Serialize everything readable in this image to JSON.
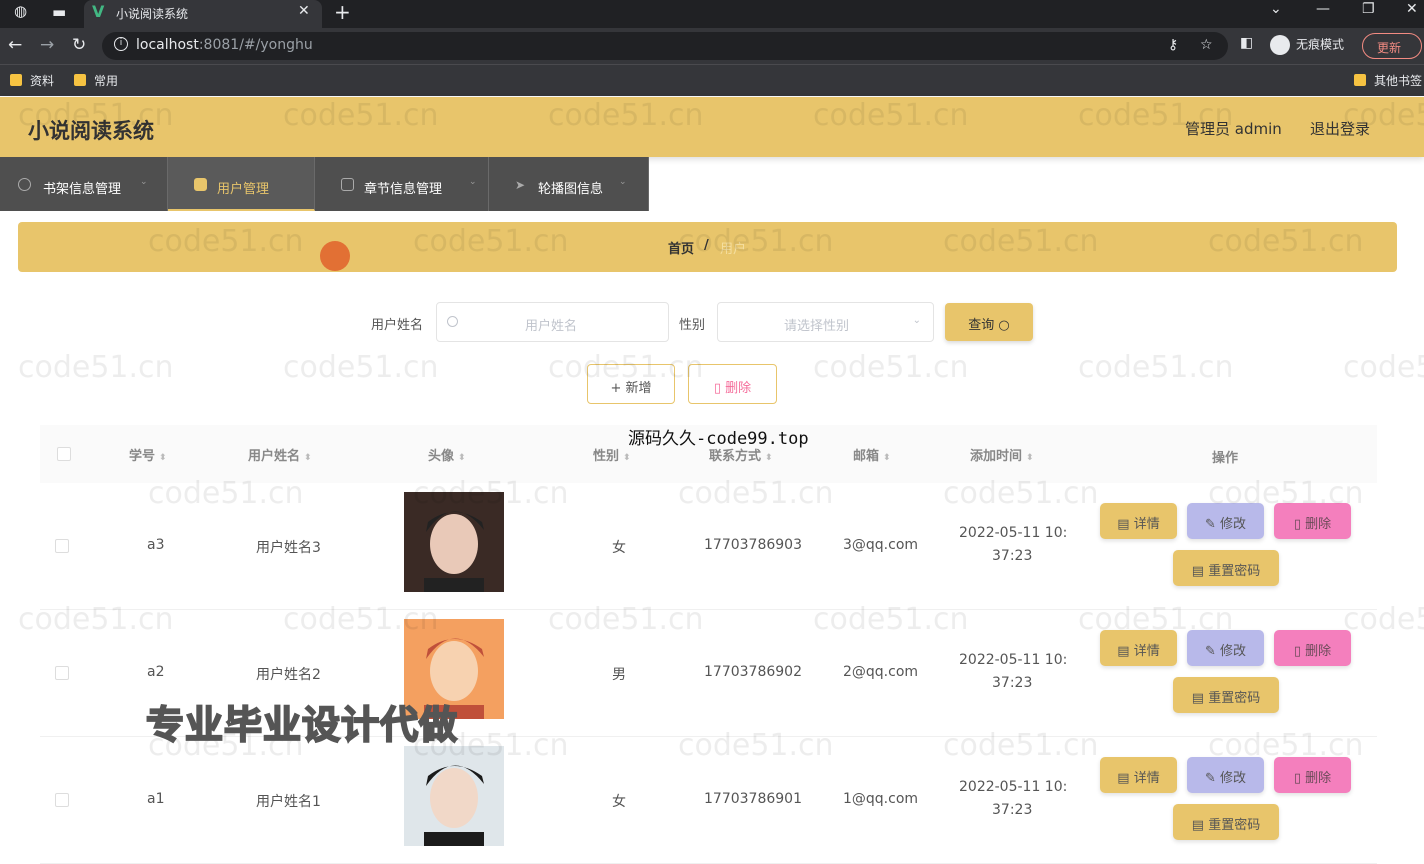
{
  "browser": {
    "tab_title": "小说阅读系统",
    "url_host": "localhost",
    "url_rest": ":8081/#/yonghu",
    "incognito_label": "无痕模式",
    "update_label": "更新",
    "bookmarks": [
      "资料",
      "常用"
    ],
    "other_bookmarks": "其他书签"
  },
  "app": {
    "title": "小说阅读系统",
    "user_label": "管理员 admin",
    "logout_label": "退出登录"
  },
  "menu": [
    {
      "label": "书架信息管理",
      "icon": "compass-icon"
    },
    {
      "label": "用户管理",
      "icon": "user-card-icon"
    },
    {
      "label": "章节信息管理",
      "icon": "document-icon"
    },
    {
      "label": "轮播图信息",
      "icon": "send-icon"
    }
  ],
  "breadcrumb": {
    "home": "首页",
    "sep": "/",
    "current": "用户"
  },
  "search": {
    "name_label": "用户姓名",
    "name_placeholder": "用户姓名",
    "gender_label": "性别",
    "gender_placeholder": "请选择性别",
    "query_label": "查询"
  },
  "toolbar": {
    "add_label": "+ 新增",
    "delete_label": "删除"
  },
  "table": {
    "columns": [
      "学号",
      "用户姓名",
      "头像",
      "性别",
      "联系方式",
      "邮箱",
      "添加时间",
      "操作"
    ],
    "rows": [
      {
        "id": "a3",
        "name": "用户姓名3",
        "gender": "女",
        "phone": "17703786903",
        "email": "3@qq.com",
        "time1": "2022-05-11 10:",
        "time2": "37:23"
      },
      {
        "id": "a2",
        "name": "用户姓名2",
        "gender": "男",
        "phone": "17703786902",
        "email": "2@qq.com",
        "time1": "2022-05-11 10:",
        "time2": "37:23"
      },
      {
        "id": "a1",
        "name": "用户姓名1",
        "gender": "女",
        "phone": "17703786901",
        "email": "1@qq.com",
        "time1": "2022-05-11 10:",
        "time2": "37:23"
      }
    ],
    "actions": {
      "detail": "详情",
      "edit": "修改",
      "delete": "删除",
      "reset": "重置密码"
    }
  },
  "overlays": {
    "watermark": "code51.cn",
    "caption_top": "源码久久-code99.top",
    "caption_bottom": "专业毕业设计代做"
  },
  "colors": {
    "accent": "#e8c56b",
    "menu_bg": "#4f4f4f",
    "edit": "#b8b9ea",
    "delete": "#f47fbd"
  }
}
